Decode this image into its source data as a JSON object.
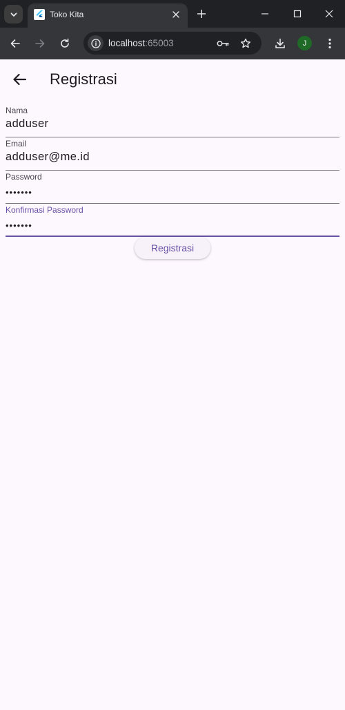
{
  "browser": {
    "tab_title": "Toko Kita",
    "url_host": "localhost",
    "url_port": ":65003",
    "profile_initial": "J"
  },
  "appbar": {
    "title": "Registrasi"
  },
  "form": {
    "nama": {
      "label": "Nama",
      "value": "adduser"
    },
    "email": {
      "label": "Email",
      "value": "adduser@me.id"
    },
    "password": {
      "label": "Password",
      "value": "•••••••"
    },
    "konfirmasi": {
      "label": "Konfirmasi Password",
      "value": "•••••••"
    },
    "submit_label": "Registrasi"
  },
  "colors": {
    "accent": "#6750a4",
    "background": "#fdf7fe",
    "chrome_dark": "#202124",
    "chrome_toolbar": "#35363a"
  }
}
